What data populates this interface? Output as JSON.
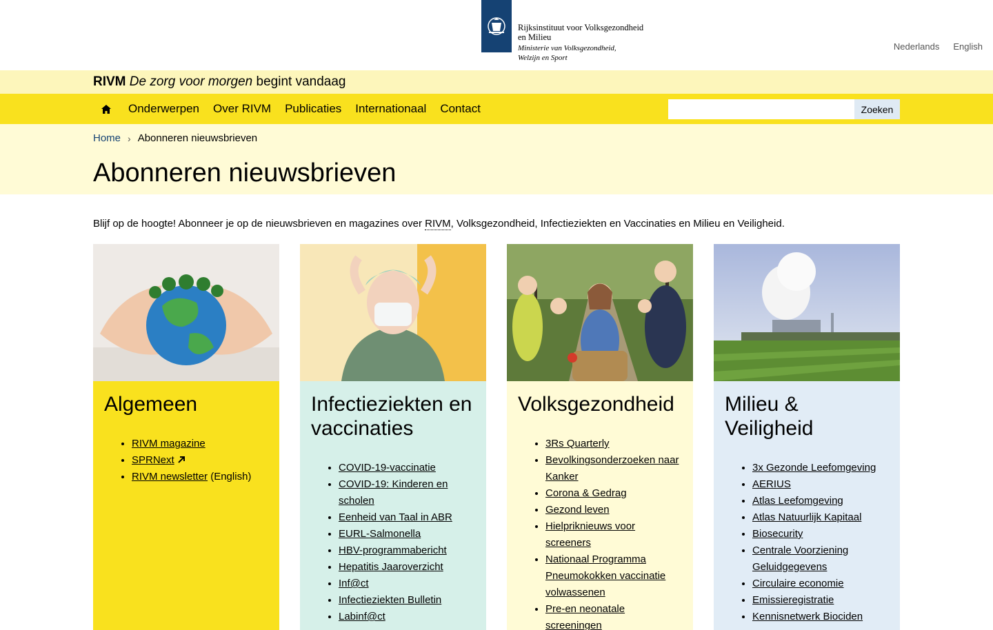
{
  "header": {
    "org_line1": "Rijksinstituut voor Volksgezondheid",
    "org_line2": "en Milieu",
    "ministry_line1": "Ministerie van Volksgezondheid,",
    "ministry_line2": "Welzijn en Sport",
    "languages": [
      "Nederlands",
      "English"
    ]
  },
  "tagline": {
    "brand": "RIVM",
    "italic": "De zorg voor morgen",
    "rest": "begint vandaag"
  },
  "nav": {
    "items": [
      "Onderwerpen",
      "Over RIVM",
      "Publicaties",
      "Internationaal",
      "Contact"
    ],
    "search_button": "Zoeken",
    "search_placeholder": ""
  },
  "breadcrumb": {
    "home": "Home",
    "current": "Abonneren nieuwsbrieven"
  },
  "page": {
    "title": "Abonneren nieuwsbrieven",
    "intro_before": "Blijf op de hoogte! Abonneer je op de nieuwsbrieven en magazines over ",
    "intro_abbr": "RIVM",
    "intro_after": ", Volksgezondheid, Infectieziekten en Vaccinaties en Milieu en Veiligheid."
  },
  "cards": [
    {
      "title": "Algemeen",
      "items": [
        "RIVM magazine",
        "SPRNext",
        "RIVM newsletter"
      ],
      "item_suffix": "(English)"
    },
    {
      "title": "Infectieziekten en vaccinaties",
      "items": [
        "COVID-19-vaccinatie",
        "COVID-19: Kinderen en scholen",
        "Eenheid van Taal in ABR",
        "EURL-Salmonella",
        "HBV-programmabericht",
        "Hepatitis Jaaroverzicht",
        "Inf@ct",
        "Infectieziekten Bulletin",
        "Labinf@ct"
      ]
    },
    {
      "title": "Volksgezondheid",
      "items": [
        "3Rs Quarterly",
        "Bevolkingsonderzoeken naar Kanker",
        "Corona & Gedrag",
        "Gezond leven",
        "Hielpriknieuws voor screeners",
        "Nationaal Programma Pneumokokken vaccinatie volwassenen",
        "Pre-en neonatale screeningen"
      ]
    },
    {
      "title": "Milieu & Veiligheid",
      "items": [
        "3x Gezonde Leefomgeving",
        "AERIUS",
        "Atlas Leefomgeving",
        "Atlas Natuurlijk Kapitaal",
        "Biosecurity",
        "Centrale Voorziening Geluidgegevens",
        "Circulaire economie",
        "Emissieregistratie",
        "Kennisnetwerk Biociden"
      ]
    }
  ],
  "colors": {
    "yellow": "#f9e11e",
    "light_yellow": "#fffbd6",
    "mint": "#d6f0e9",
    "light_blue": "#e1ecf6",
    "logo_blue": "#154273"
  },
  "icons": {
    "logo": "dutch-coat-of-arms-icon",
    "home": "home-icon",
    "external": "external-link-arrow-icon"
  }
}
